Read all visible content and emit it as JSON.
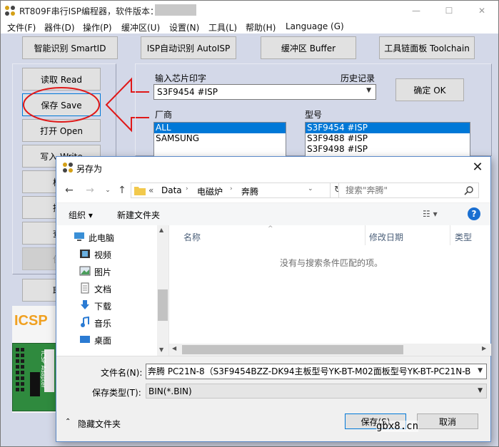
{
  "app": {
    "title": "RT809F串行ISP编程器，软件版本：",
    "menu": [
      "文件(F)",
      "器件(D)",
      "操作(P)",
      "缓冲区(U)",
      "设置(N)",
      "工具(L)",
      "帮助(H)",
      "Language (G)"
    ],
    "top_buttons": [
      "智能识别 SmartID",
      "ISP自动识别 AutoISP",
      "缓冲区 Buffer",
      "工具链面板 Toolchain"
    ],
    "left_buttons": [
      "读取 Read",
      "保存 Save",
      "打开 Open",
      "写入 Write",
      "校验",
      "擦除",
      "查空",
      "保护",
      "取消"
    ],
    "chip_input_label": "输入芯片印字",
    "history_label": "历史记录",
    "chip_value": "S3F9454 #ISP",
    "confirm_button": "确定 OK",
    "vendor_label": "厂商",
    "vendors": [
      "ALL",
      "SAMSUNG"
    ],
    "model_label": "型号",
    "models": [
      "S3F9454 #ISP",
      "S3F9488 #ISP",
      "S3F9498 #ISP"
    ],
    "icsp_label": "ICSP",
    "icsp_board_text": "ICSP Adapter"
  },
  "dialog": {
    "title": "另存为",
    "path": [
      "Data",
      "电磁炉",
      "奔腾"
    ],
    "path_prefix": "«",
    "search_placeholder": "搜索\"奔腾\"",
    "organize": "组织 ▾",
    "new_folder": "新建文件夹",
    "nav_items": [
      "此电脑",
      "视频",
      "图片",
      "文档",
      "下载",
      "音乐",
      "桌面"
    ],
    "columns": [
      "名称",
      "修改日期",
      "类型"
    ],
    "empty_message": "没有与搜索条件匹配的项。",
    "filename_label": "文件名(N):",
    "filename_value": "奔腾 PC21N-8（S3F9454BZZ-DK94主板型号YK-BT-M02面板型号YK-BT-PC21N-B",
    "filetype_label": "保存类型(T):",
    "filetype_value": "BIN(*.BIN)",
    "hide_folders": "隐藏文件夹",
    "save_button": "保存(S)",
    "cancel_button": "取消"
  },
  "watermark": "gbx8.cn",
  "colors": {
    "app_bg": "#d3d8e8",
    "selection": "#0078d7",
    "annotation": "#e01818",
    "help": "#1a6fd1"
  }
}
